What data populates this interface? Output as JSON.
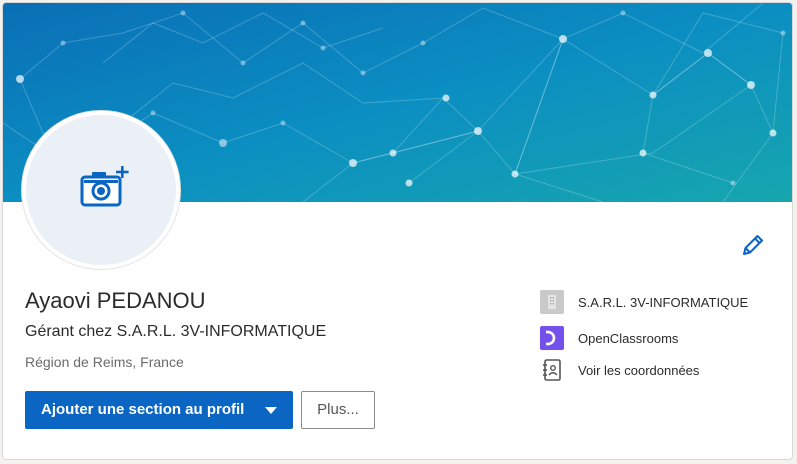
{
  "profile": {
    "name": "Ayaovi PEDANOU",
    "headline": "Gérant chez S.A.R.L. 3V-INFORMATIQUE",
    "location": "Région de Reims, France"
  },
  "actions": {
    "add_section_label": "Ajouter une section au profil",
    "more_label": "Plus..."
  },
  "sidebar": {
    "items": [
      {
        "label": "S.A.R.L. 3V-INFORMATIQUE",
        "icon": "company-icon"
      },
      {
        "label": "OpenClassrooms",
        "icon": "school-logo-icon"
      },
      {
        "label": "Voir les coordonnées",
        "icon": "contact-card-icon"
      }
    ]
  },
  "colors": {
    "primary": "#0a66c2",
    "banner_start": "#0b74b8",
    "banner_end": "#13a3b0",
    "openclassrooms": "#7451eb"
  }
}
